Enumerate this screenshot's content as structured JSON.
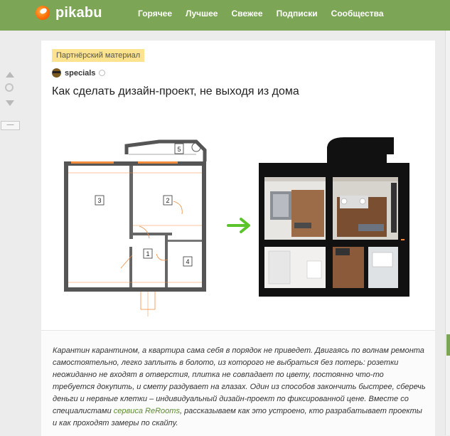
{
  "header": {
    "logo_text": "pikabu",
    "nav": [
      "Горячее",
      "Лучшее",
      "Свежее",
      "Подписки",
      "Сообщества"
    ]
  },
  "sidebar": {
    "collapse_label": "—"
  },
  "post": {
    "badge": "Партнёрский материал",
    "author": "specials",
    "title": "Как сделать дизайн-проект, не выходя из дома",
    "body_before_link": "Карантин карантином, а квартира сама себя в порядок не приведет. Двигаясь по волнам ремонта самостоятельно, легко заплыть в болото, из которого не выбраться без потерь: розетки неожиданно не входят в отверстия, плитка не совпадает по цвету, постоянно что-то требуется докупить, и смету раздувает на глазах. Один из способов закончить быстрее, сберечь деньги и нервные клетки – индивидуальный дизайн-проект по фиксированной цене. Вместе со специалистами ",
    "link_text": "сервиса ReRooms",
    "body_after_link": ", рассказываем как это устроено, кто разрабатывает проекты и как проходят замеры по скайпу."
  },
  "floorplan": {
    "rooms": [
      "1",
      "2",
      "3",
      "4",
      "5"
    ]
  },
  "colors": {
    "brand_green": "#7da556",
    "badge_bg": "#fbe38f",
    "link": "#5b8a2f",
    "arrow": "#5bc42a"
  }
}
